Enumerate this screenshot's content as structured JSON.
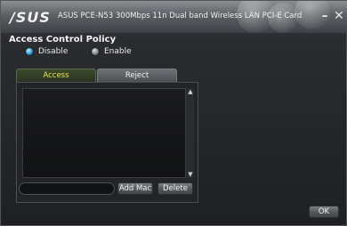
{
  "window": {
    "logo": "/SUS",
    "title": "ASUS PCE-N53 300Mbps 11n Dual band Wireless LAN PCI-E Card",
    "minimize_symbol": "–",
    "close_symbol": "✕"
  },
  "section_title": "Access Control Policy",
  "policy": {
    "options": [
      {
        "label": "Disable",
        "selected": true
      },
      {
        "label": "Enable",
        "selected": false
      }
    ]
  },
  "tabs": [
    {
      "label": "Access",
      "active": true
    },
    {
      "label": "Reject",
      "active": false
    }
  ],
  "mac_list": {
    "items": []
  },
  "mac_input": {
    "value": ""
  },
  "buttons": {
    "add_mac": "Add Mac",
    "delete": "Delete",
    "ok": "OK"
  },
  "icons": {
    "scroll_up": "▲",
    "scroll_down": "▼"
  },
  "colors": {
    "active_tab_text": "#e3e84a",
    "selected_radio": "#2a9ad6"
  }
}
